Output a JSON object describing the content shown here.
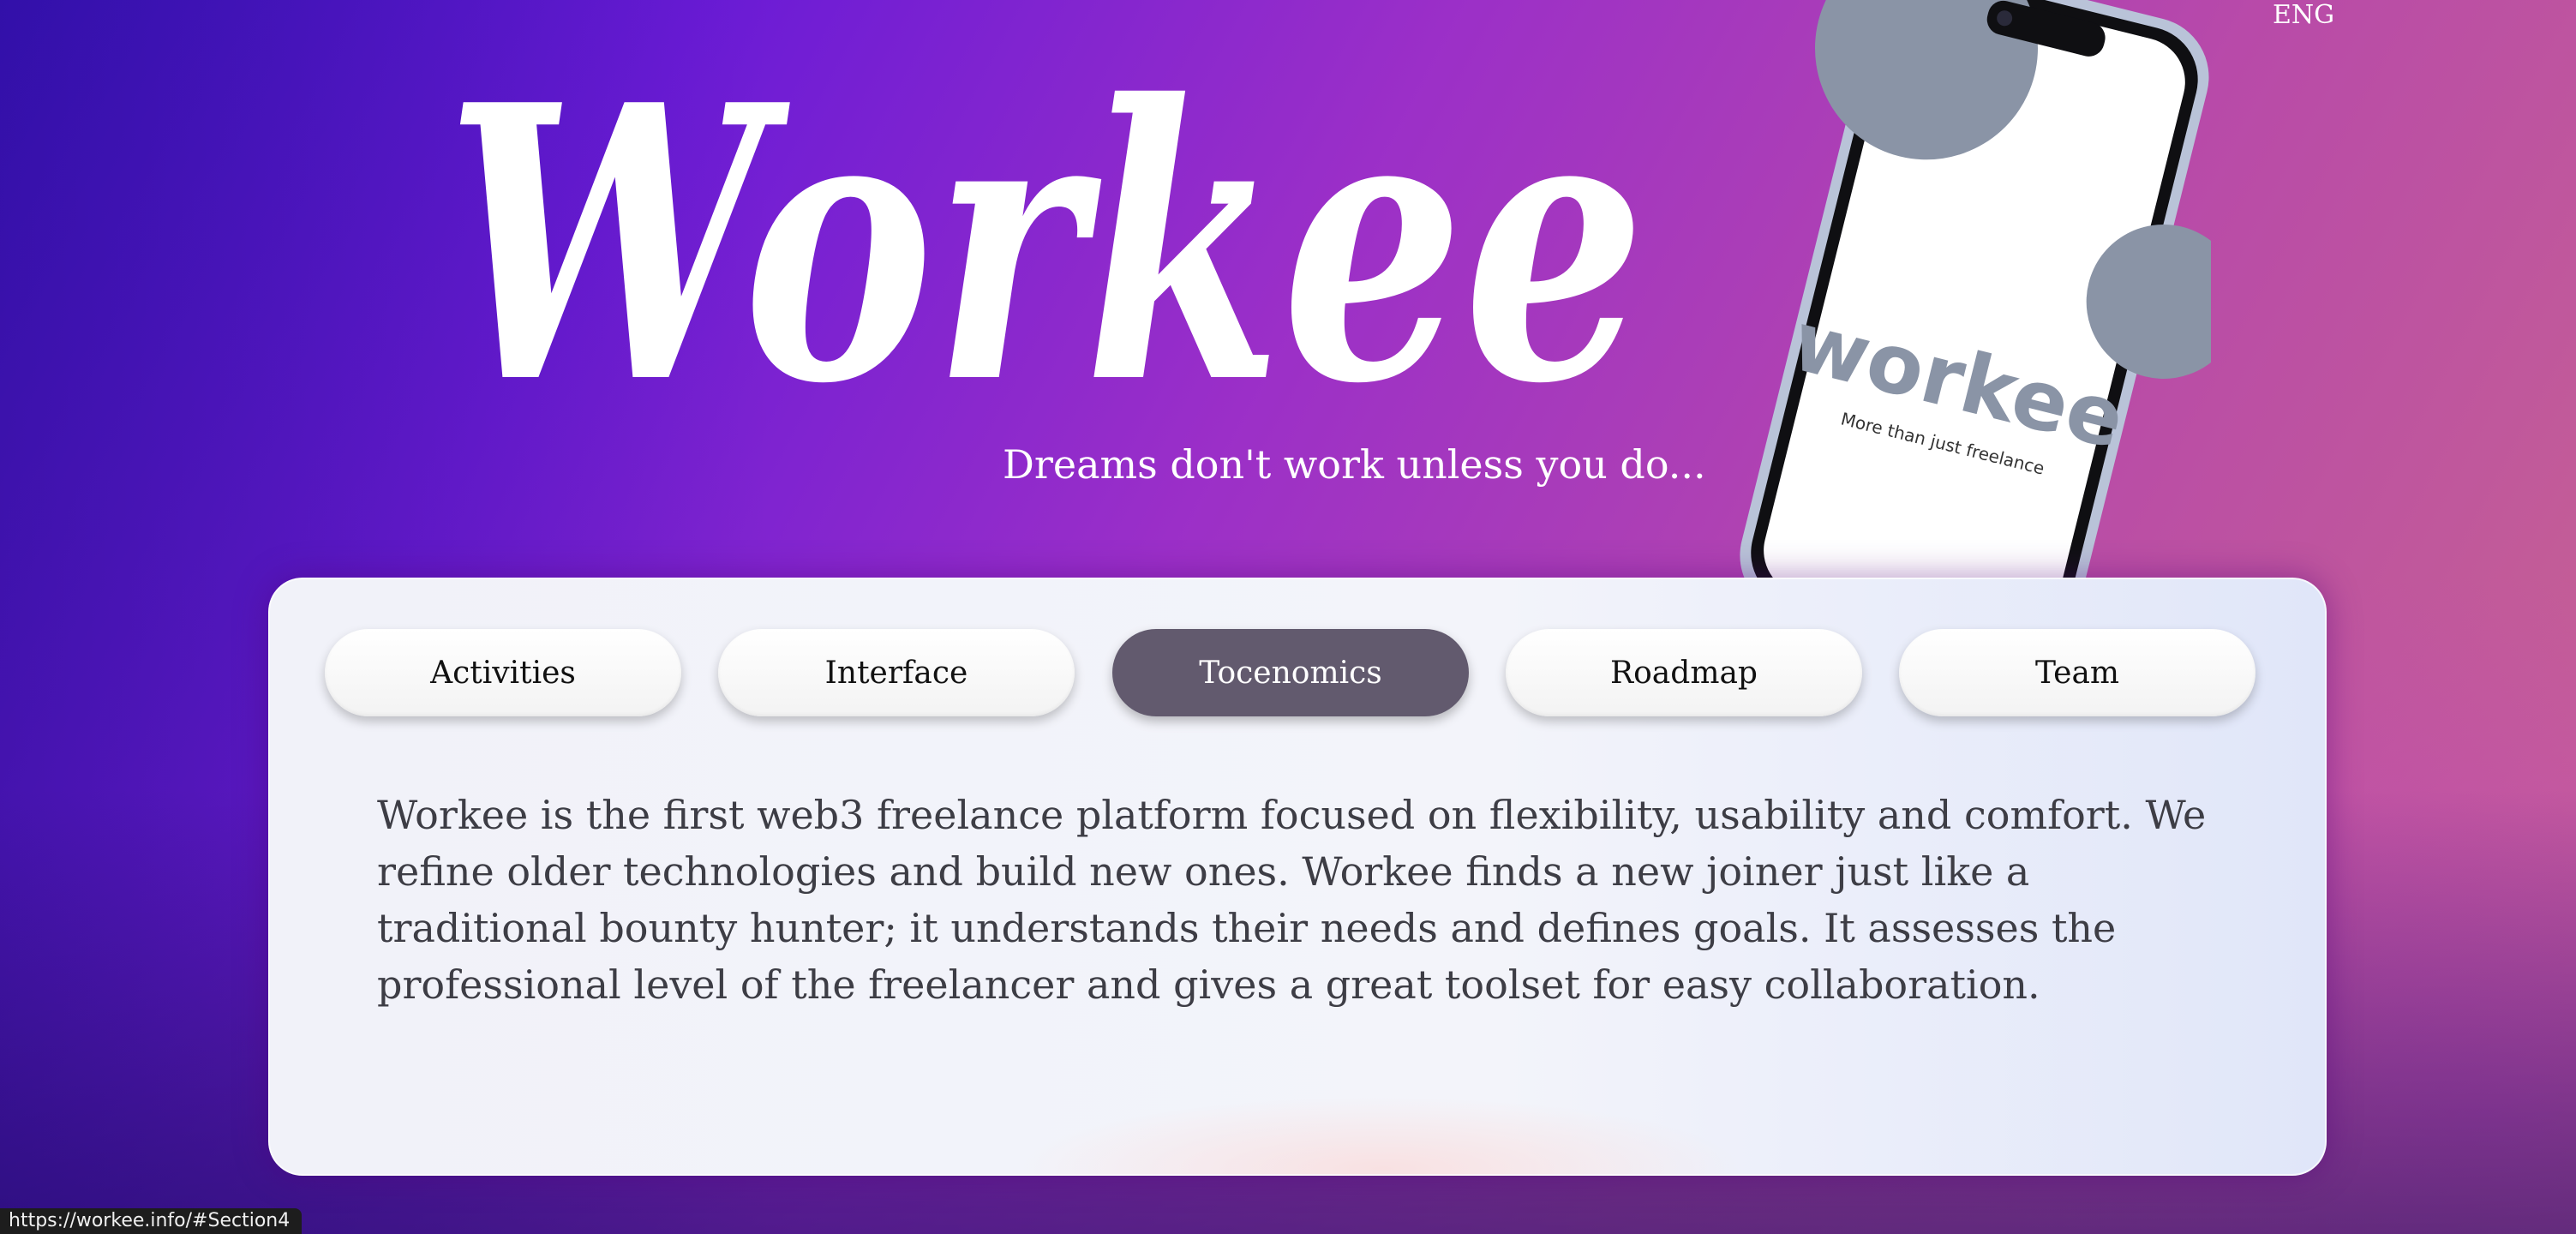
{
  "header": {
    "language": "ENG",
    "logo_text": "Workee",
    "tagline": "Dreams don't work unless you do..."
  },
  "phone": {
    "app_name": "workee",
    "app_slogan": "More than just freelance"
  },
  "tabs": [
    {
      "label": "Activities",
      "active": false
    },
    {
      "label": "Interface",
      "active": false
    },
    {
      "label": "Tocenomics",
      "active": true
    },
    {
      "label": "Roadmap",
      "active": false
    },
    {
      "label": "Team",
      "active": false
    }
  ],
  "content": {
    "description": "Workee is the first web3 freelance platform focused on flexibility, usability and comfort. We refine older technologies and build new ones. Workee finds a new joiner just like a traditional bounty hunter; it understands their needs and defines goals. It assesses the professional level of the freelancer and gives a great toolset for easy collaboration."
  },
  "status_bar": {
    "url": "https://workee.info/#Section4"
  },
  "colors": {
    "active_tab": "#625a6e",
    "panel": "#f1f2f9",
    "bg_start": "#3a12c9",
    "bg_end": "#c9678d"
  }
}
